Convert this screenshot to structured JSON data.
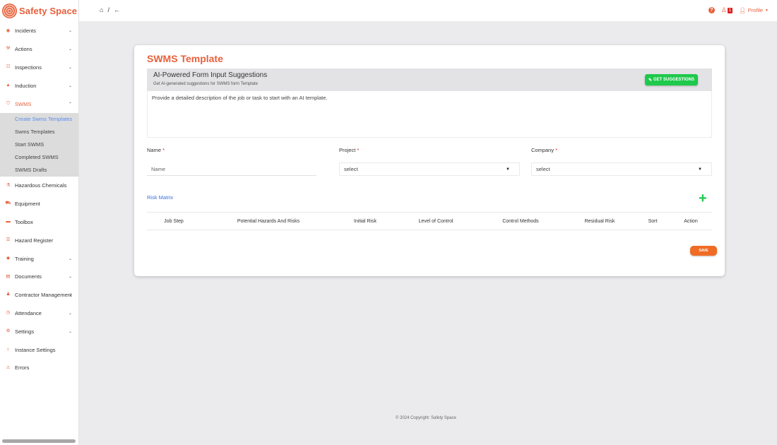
{
  "brand": {
    "name": "Safety Space",
    "color": "#e8603c"
  },
  "sidebar": {
    "items": [
      {
        "label": "Incidents",
        "icon": "incident-icon",
        "glyph": "◉",
        "chevron": "⌄"
      },
      {
        "label": "Actions",
        "icon": "hammer-icon",
        "glyph": "⚒",
        "chevron": "⌄"
      },
      {
        "label": "Inspections",
        "icon": "checklist-icon",
        "glyph": "☷",
        "chevron": "⌄"
      },
      {
        "label": "Induction",
        "icon": "hardhat-icon",
        "glyph": "▲",
        "chevron": "⌄"
      },
      {
        "label": "SWMS",
        "icon": "shield-icon",
        "glyph": "⛉",
        "chevron": "⌃"
      },
      {
        "label": "Hazardous Chemicals",
        "icon": "flask-icon",
        "glyph": "⚗",
        "chevron": ""
      },
      {
        "label": "Equipment",
        "icon": "truck-icon",
        "glyph": "⛟",
        "chevron": ""
      },
      {
        "label": "Toolbox",
        "icon": "toolbox-icon",
        "glyph": "▬",
        "chevron": ""
      },
      {
        "label": "Hazard Register",
        "icon": "list-icon",
        "glyph": "☰",
        "chevron": ""
      },
      {
        "label": "Training",
        "icon": "graduation-cap-icon",
        "glyph": "◆",
        "chevron": "⌄"
      },
      {
        "label": "Documents",
        "icon": "document-icon",
        "glyph": "▤",
        "chevron": "⌄"
      },
      {
        "label": "Contractor Management",
        "icon": "users-icon",
        "glyph": "♟",
        "chevron": "⌄"
      },
      {
        "label": "Attendance",
        "icon": "clock-icon",
        "glyph": "◷",
        "chevron": "⌄"
      },
      {
        "label": "Settings",
        "icon": "gears-icon",
        "glyph": "⚙",
        "chevron": "⌄"
      },
      {
        "label": "Instance Settings",
        "icon": "building-icon",
        "glyph": "⌂",
        "chevron": ""
      },
      {
        "label": "Errors",
        "icon": "warning-icon",
        "glyph": "⚠",
        "chevron": ""
      }
    ],
    "swms_sub": [
      "Create Swms Templates",
      "Swms Templates",
      "Start SWMS",
      "Completed SWMS",
      "SWMS Drafts"
    ]
  },
  "topbar": {
    "home_glyph": "⌂",
    "separator": "/",
    "back_glyph": "←",
    "help_glyph": "?",
    "notification_count": "1",
    "profile_label": "Profile"
  },
  "form": {
    "title": "SWMS Template",
    "ai": {
      "title": "AI-Powered Form Input Suggestions",
      "subtitle": "Get AI-generated suggestions for SWMS form Template",
      "button": "GET SUGGESTIONS",
      "placeholder": "Provide a detailed description of the job or task to start with an AI template."
    },
    "name_label": "Name",
    "name_placeholder": "Name",
    "project_label": "Project",
    "project_value": "select",
    "company_label": "Company",
    "company_value": "select",
    "required_mark": "*",
    "risk_matrix_label": "Risk Matrix",
    "add_glyph": "+",
    "table_headers": [
      "Job Step",
      "Potential Hazards And Risks",
      "Initial Risk",
      "Level of Control",
      "Control Methods",
      "Residual Risk",
      "Sort",
      "Action"
    ],
    "save_label": "SAVE"
  },
  "footer": "© 2024 Copyright: Safety Space",
  "colors": {
    "accent": "#e8603c",
    "success": "#1ec94c",
    "link": "#3d6fd8",
    "save": "#f06b24"
  }
}
